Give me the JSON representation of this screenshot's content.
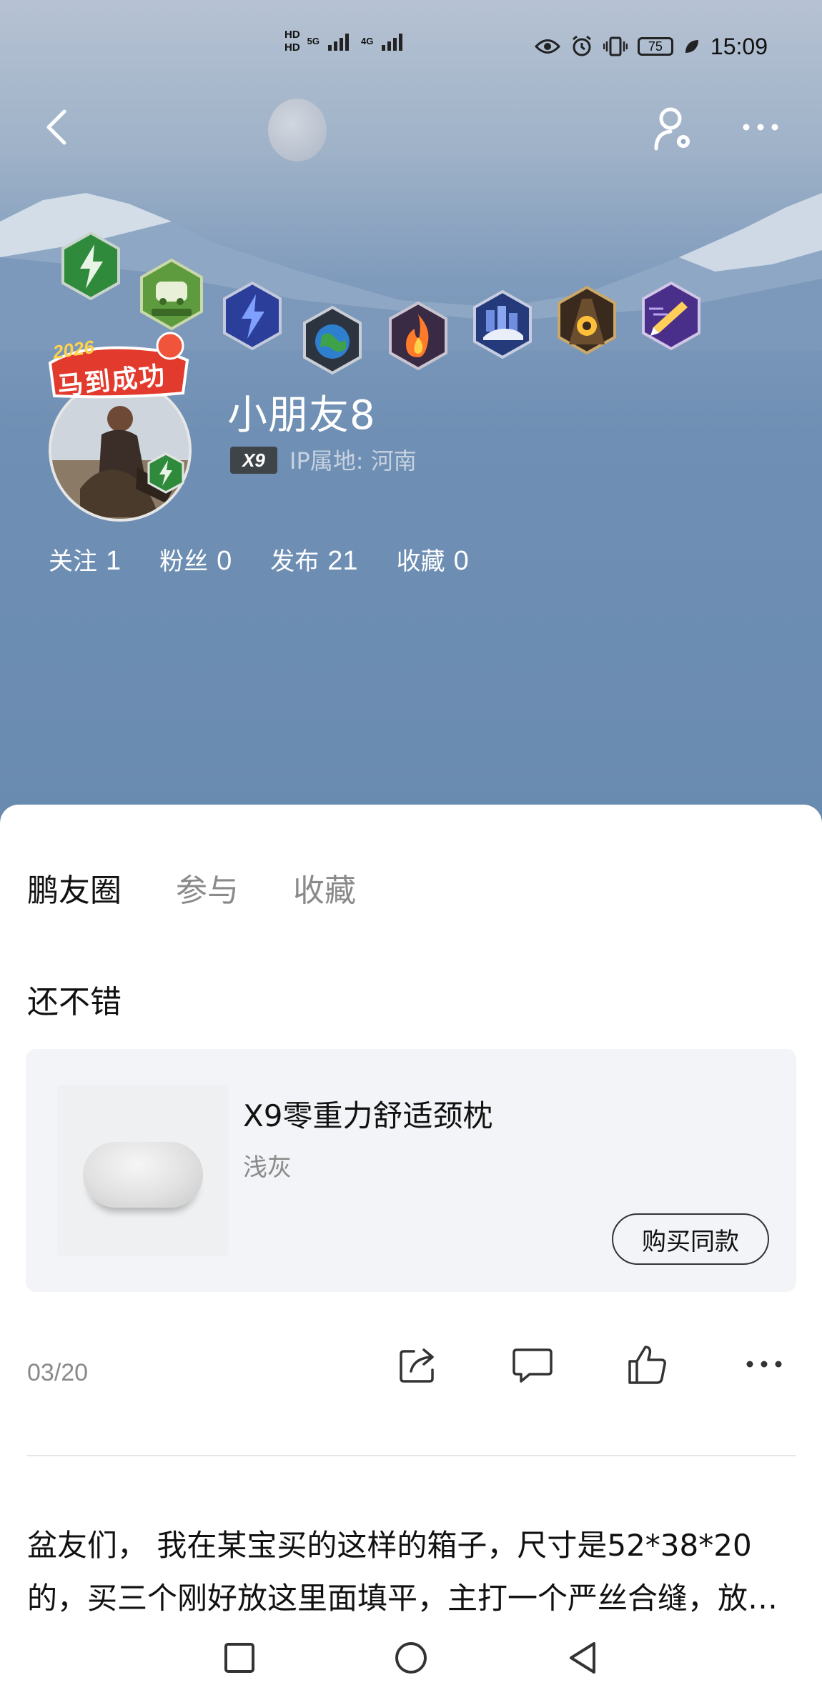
{
  "status_bar": {
    "hd1": "HD",
    "hd2": "HD",
    "net1": "5G",
    "net2": "4G",
    "battery": "75",
    "time": "15:09"
  },
  "profile": {
    "username": "小朋友8",
    "car_tag": "X9",
    "ip_location": "IP属地: 河南",
    "avatar_frame_text_year": "2026",
    "avatar_frame_text": "马到成功",
    "stats": [
      {
        "label": "关注",
        "value": "1"
      },
      {
        "label": "粉丝",
        "value": "0"
      },
      {
        "label": "发布",
        "value": "21"
      },
      {
        "label": "收藏",
        "value": "0"
      }
    ]
  },
  "tabs": [
    {
      "label": "鹏友圈",
      "active": true
    },
    {
      "label": "参与",
      "active": false
    },
    {
      "label": "收藏",
      "active": false
    }
  ],
  "post": {
    "title": "还不错",
    "product": {
      "name": "X9零重力舒适颈枕",
      "variant": "浅灰",
      "buy_label": "购买同款"
    },
    "date": "03/20",
    "next_post_text": "盆友们， 我在某宝买的这样的箱子，尺寸是52*38*20的，买三个刚好放这里面填平，主打一个严丝合缝，放东西稳稳当当的"
  },
  "icons": {
    "back": "back-arrow-icon",
    "user_settings": "user-settings-icon",
    "more": "more-icon",
    "share": "share-icon",
    "comment": "comment-icon",
    "like": "like-icon"
  },
  "colors": {
    "hero_top": "#b6c2d3",
    "hero_bottom": "#6a8bb0",
    "tab_inactive": "#8a8a8a",
    "card_bg": "#f2f4f7"
  }
}
